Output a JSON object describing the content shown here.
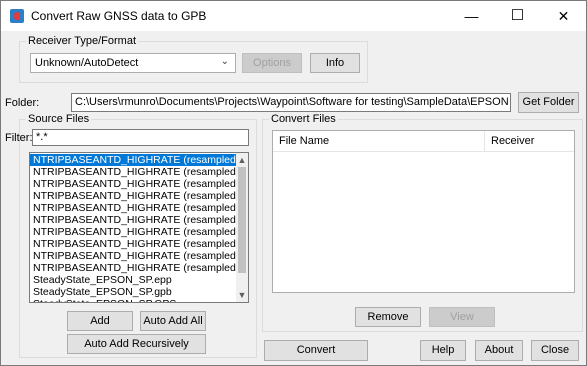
{
  "window": {
    "title": "Convert Raw GNSS data to GPB",
    "minimize": "—",
    "maximize": "☐",
    "close": "✕",
    "icon": "gnss-app-icon"
  },
  "receiver": {
    "group_label": "Receiver Type/Format",
    "selected": "Unknown/AutoDetect",
    "options_label": "Options",
    "info_label": "Info"
  },
  "folder": {
    "label": "Folder:",
    "path": "C:\\Users\\rmunro\\Documents\\Projects\\Waypoint\\Software for testing\\SampleData\\EPSON",
    "get_folder_label": "Get Folder"
  },
  "source": {
    "group_label": "Source Files",
    "filter_label": "Filter:",
    "filter_value": "*.*",
    "files": [
      "NTRIPBASEANTD_HIGHRATE (resampled).epp",
      "NTRIPBASEANTD_HIGHRATE (resampled).fbp",
      "NTRIPBASEANTD_HIGHRATE (resampled).fp",
      "NTRIPBASEANTD_HIGHRATE (resampled).fsl",
      "NTRIPBASEANTD_HIGHRATE (resampled).gpb",
      "NTRIPBASEANTD_HIGHRATE (resampled).rbp",
      "NTRIPBASEANTD_HIGHRATE (resampled).rp",
      "NTRIPBASEANTD_HIGHRATE (resampled).rsl",
      "NTRIPBASEANTD_HIGHRATE (resampled).trpf",
      "NTRIPBASEANTD_HIGHRATE (resampled).trpr",
      "SteadyState_EPSON_SP.epp",
      "SteadyState_EPSON_SP.gpb",
      "SteadyState_EPSON_SP.GPS"
    ],
    "add_label": "Add",
    "auto_add_all_label": "Auto Add All",
    "auto_add_recursively_label": "Auto Add Recursively"
  },
  "convert_files": {
    "group_label": "Convert Files",
    "col_file_name": "File Name",
    "col_receiver": "Receiver",
    "remove_label": "Remove",
    "view_label": "View"
  },
  "bottom": {
    "convert_label": "Convert",
    "help_label": "Help",
    "about_label": "About",
    "close_label": "Close"
  }
}
